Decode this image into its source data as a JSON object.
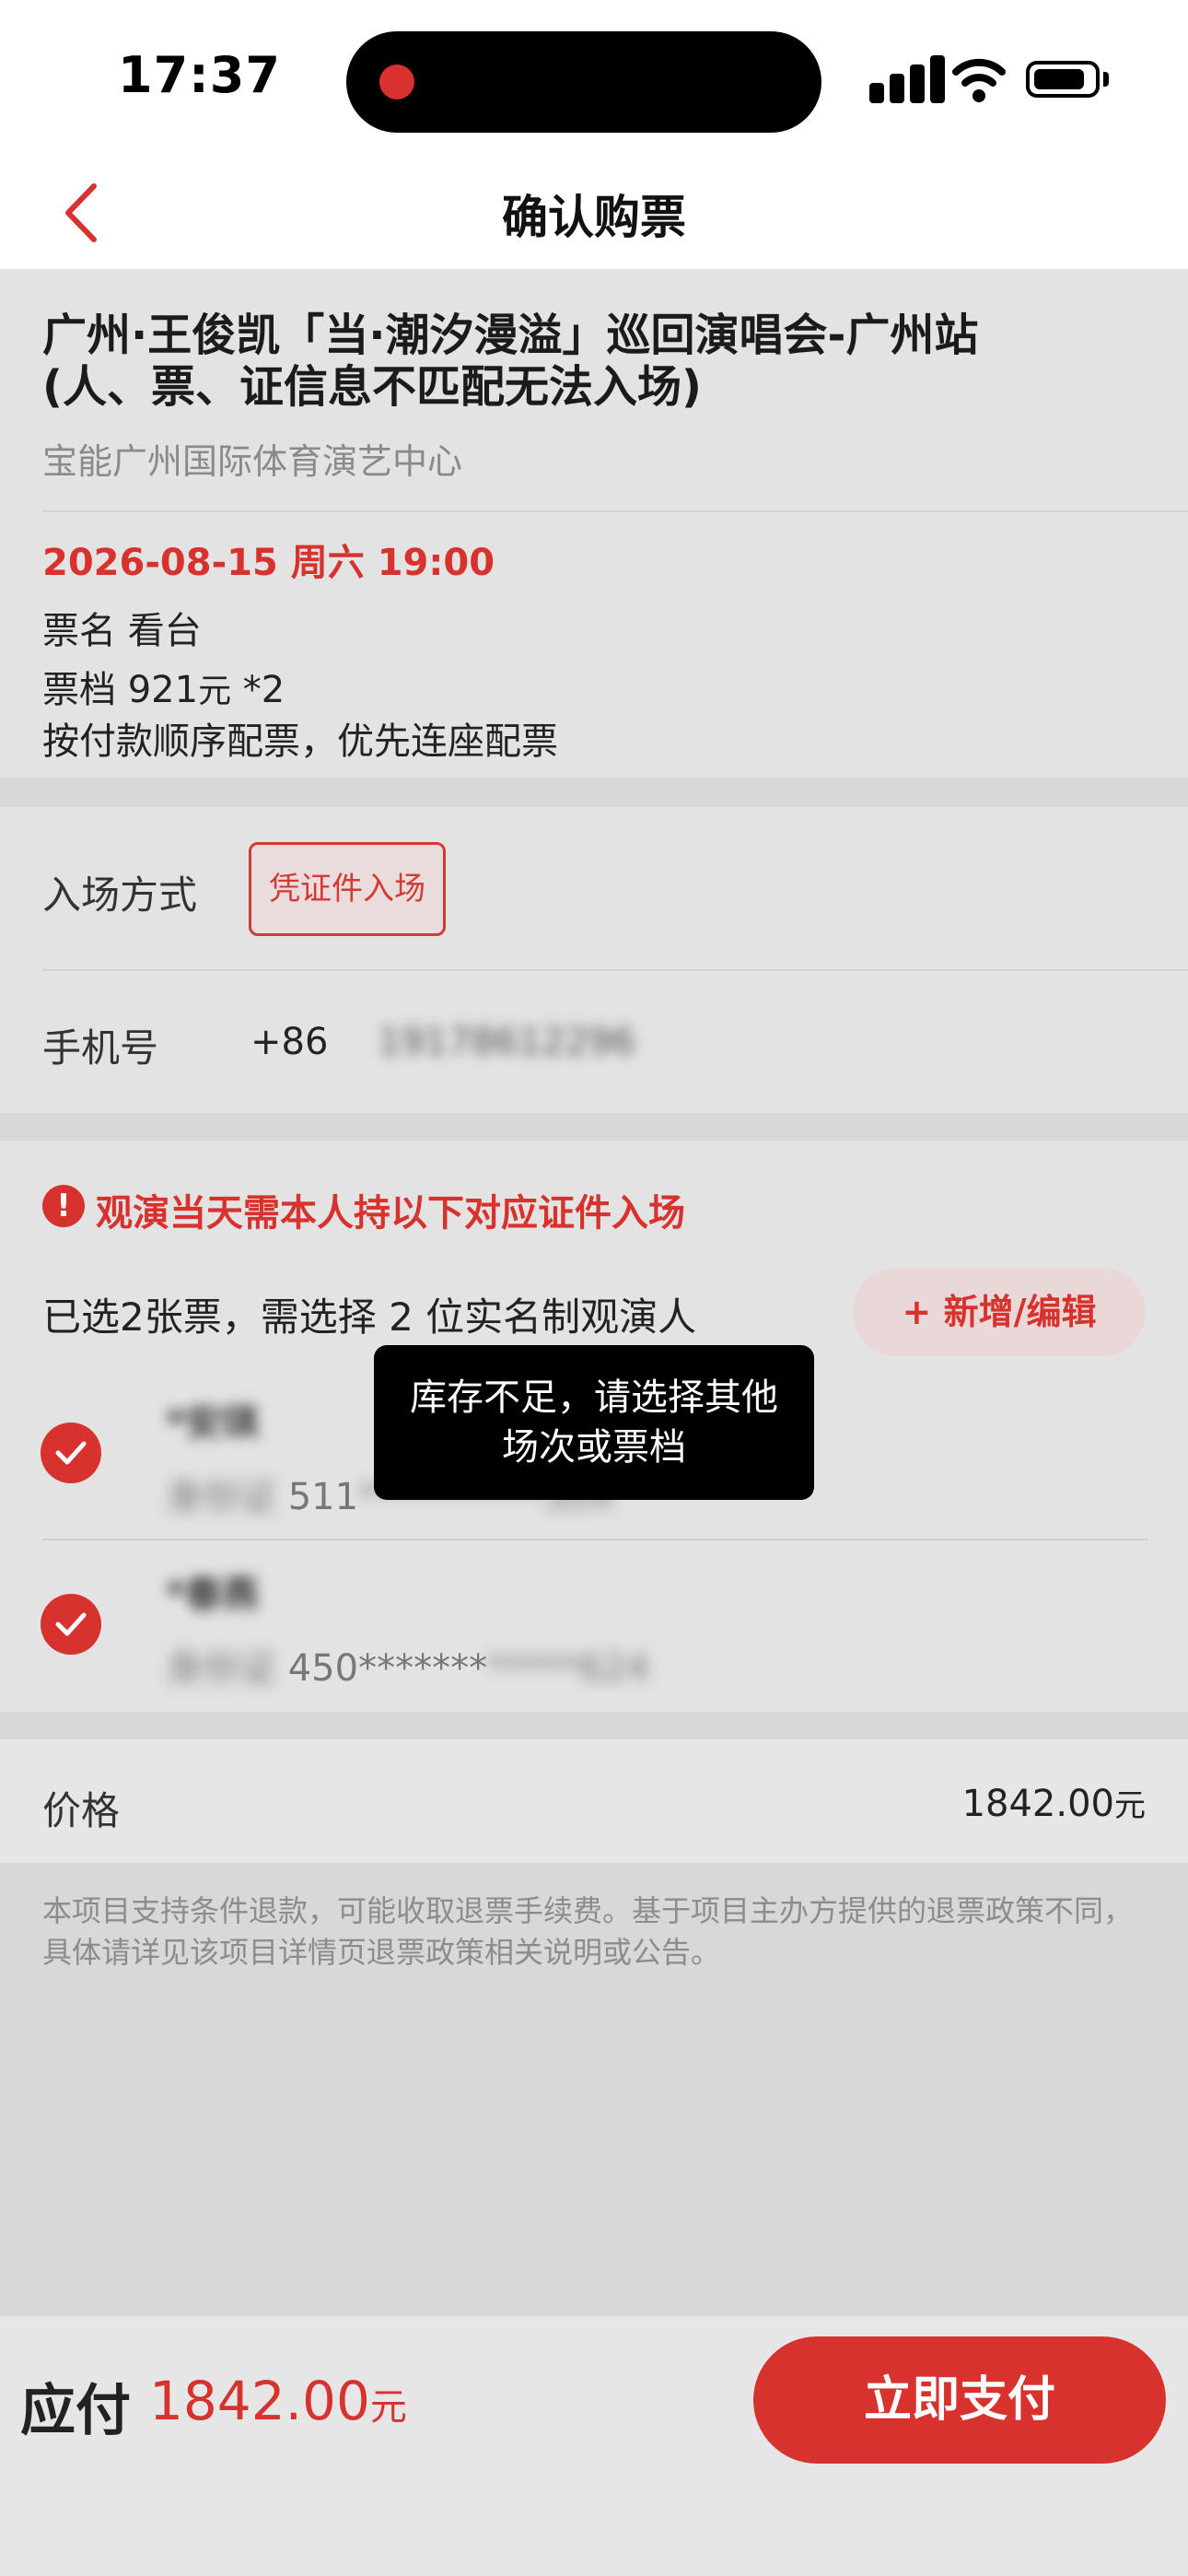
{
  "status_bar": {
    "time": "17:37"
  },
  "nav": {
    "title": "确认购票"
  },
  "show": {
    "title_line1": "广州·王俊凯「当·潮汐漫溢」巡回演唱会-广州站",
    "title_line2": "(人、票、证信息不匹配无法入场)",
    "venue": "宝能广州国际体育演艺中心",
    "datetime": "2026-08-15 周六 19:00",
    "ticket_name": "票名 看台",
    "ticket_price_prefix": "票档 921",
    "ticket_price_unit": "元",
    "ticket_qty": " *2",
    "seat_note": "按付款顺序配票，优先连座配票"
  },
  "entry": {
    "label": "入场方式",
    "method": "凭证件入场",
    "phone_label": "手机号",
    "phone_cc": "+86",
    "phone_number": "19178612296"
  },
  "attendees": {
    "warning_icon": "!",
    "warning": "观演当天需本人持以下对应证件入场",
    "select_text": "已选2张票，需选择 2 位实名制观演人",
    "add_button": "+ 新增/编辑",
    "list": [
      {
        "name": "*安琪",
        "id_label": "身份证",
        "id_prefix": "511",
        "id_rest": "**********30X"
      },
      {
        "name": "*春燕",
        "id_label": "身份证",
        "id_prefix": "450*******",
        "id_rest": "*****624"
      }
    ]
  },
  "price": {
    "label": "价格",
    "value": "1842.00",
    "unit": "元"
  },
  "refund_note": "本项目支持条件退款，可能收取退票手续费。基于项目主办方提供的退票政策不同，具体请详见该项目详情页退票政策相关说明或公告。",
  "footer": {
    "pay_label": "应付",
    "pay_amount": "1842.00",
    "pay_unit": "元",
    "pay_button": "立即支付"
  },
  "toast": {
    "line1": "库存不足，请选择其他",
    "line2": "场次或票档"
  },
  "colors": {
    "accent": "#d8322e",
    "background": "#d8d8d8",
    "card": "#e3e3e3"
  }
}
